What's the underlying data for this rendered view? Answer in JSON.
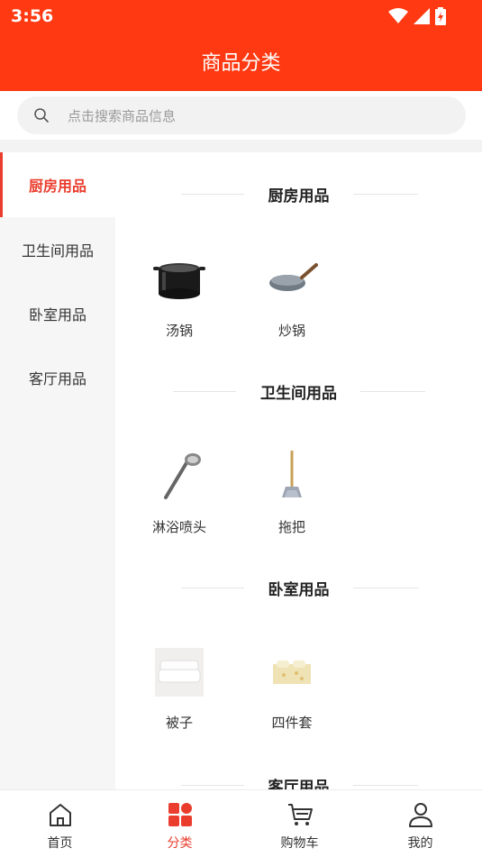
{
  "status_bar": {
    "time": "3:56"
  },
  "header": {
    "title": "商品分类"
  },
  "search": {
    "placeholder": "点击搜索商品信息",
    "icon": "search-icon"
  },
  "sidebar": {
    "active_index": 0,
    "items": [
      {
        "label": "厨房用品"
      },
      {
        "label": "卫生间用品"
      },
      {
        "label": "卧室用品"
      },
      {
        "label": "客厅用品"
      }
    ]
  },
  "sections": [
    {
      "title": "厨房用品",
      "products": [
        {
          "name": "汤锅",
          "icon": "soup-pot-icon"
        },
        {
          "name": "炒锅",
          "icon": "wok-icon"
        }
      ]
    },
    {
      "title": "卫生间用品",
      "products": [
        {
          "name": "淋浴喷头",
          "icon": "shower-head-icon"
        },
        {
          "name": "拖把",
          "icon": "mop-icon"
        }
      ]
    },
    {
      "title": "卧室用品",
      "products": [
        {
          "name": "被子",
          "icon": "quilt-icon"
        },
        {
          "name": "四件套",
          "icon": "bedding-set-icon"
        }
      ]
    },
    {
      "title": "客厅用品",
      "products": []
    }
  ],
  "tabbar": {
    "active_index": 1,
    "items": [
      {
        "label": "首页",
        "icon": "home-icon"
      },
      {
        "label": "分类",
        "icon": "category-icon"
      },
      {
        "label": "购物车",
        "icon": "cart-icon"
      },
      {
        "label": "我的",
        "icon": "profile-icon"
      }
    ]
  },
  "colors": {
    "header": "#ff3a13",
    "accent": "#ea3d2e"
  }
}
